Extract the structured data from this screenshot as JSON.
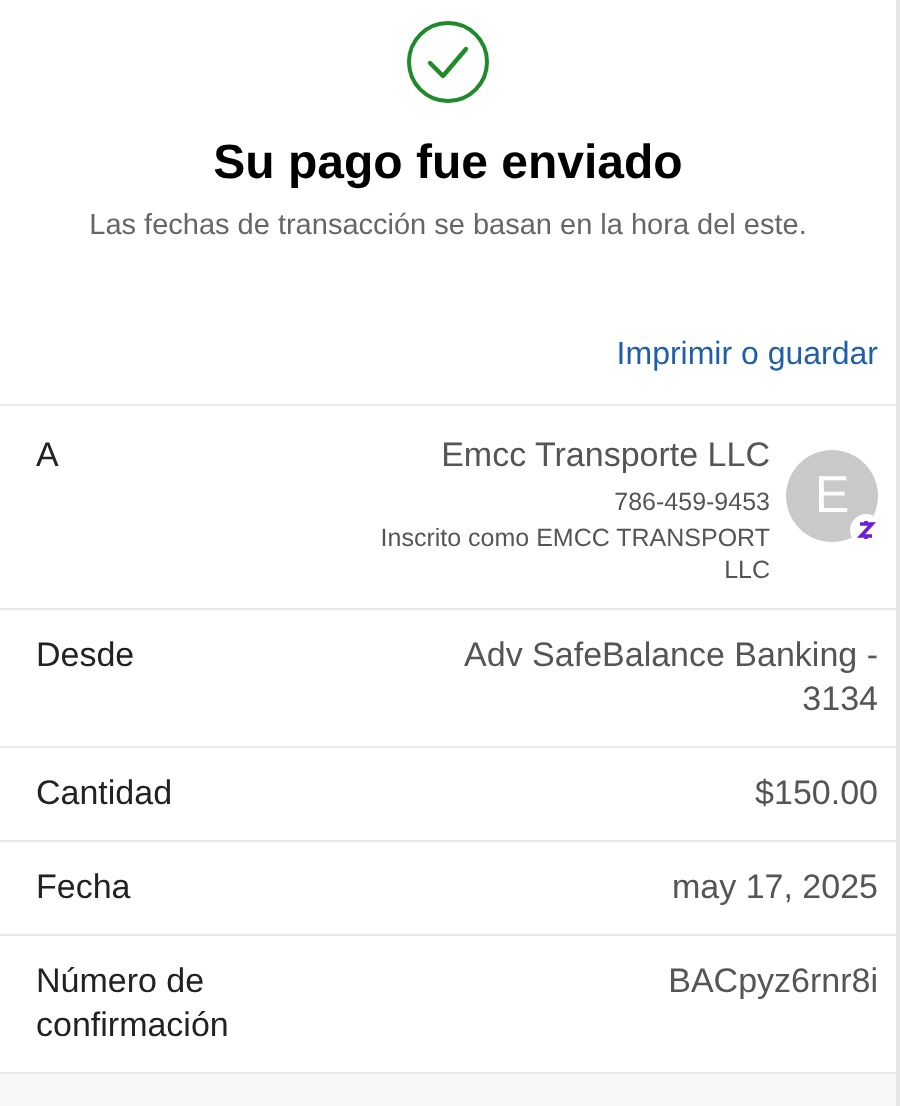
{
  "header": {
    "title": "Su pago fue enviado",
    "subtitle": "Las fechas de transacción se basan en la hora del este.",
    "link": "Imprimir o guardar"
  },
  "rows": [
    {
      "kind": "payee",
      "label": "A",
      "name": "Emcc Transporte LLC",
      "phone": "786-459-9453",
      "note": "Inscrito como EMCC TRANSPORT LLC",
      "avatar": "E"
    },
    {
      "kind": "plain",
      "label": "Desde",
      "value": "Adv SafeBalance Banking - 3134"
    },
    {
      "kind": "plain",
      "label": "Cantidad",
      "value": "$150.00"
    },
    {
      "kind": "plain",
      "label": "Fecha",
      "value": "may 17, 2025"
    },
    {
      "kind": "plain",
      "label": "Número de confirmación",
      "value": "BACpyz6rnr8i"
    }
  ]
}
